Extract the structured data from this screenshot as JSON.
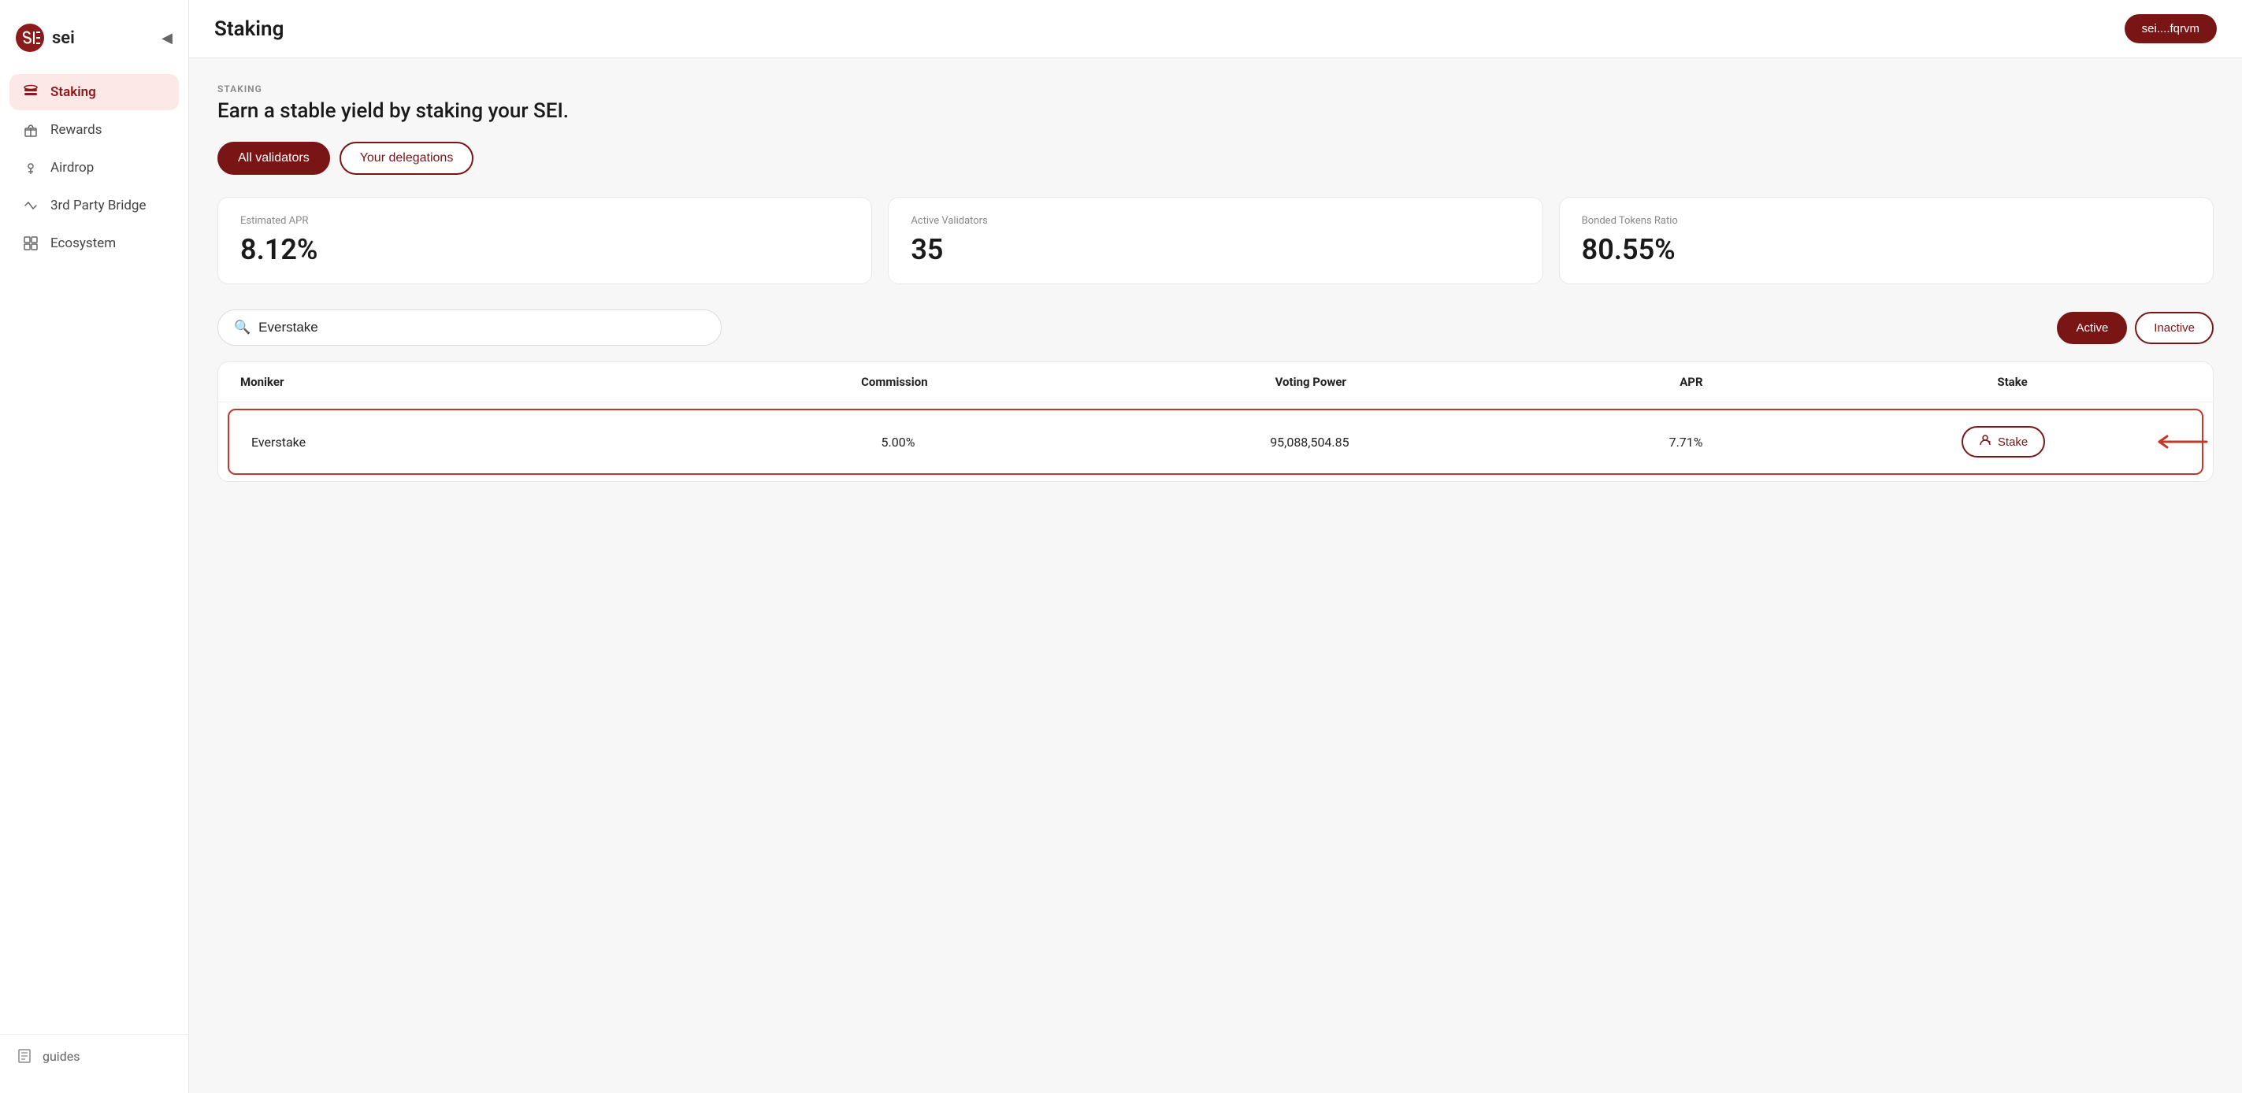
{
  "app": {
    "name": "sei"
  },
  "header": {
    "title": "Staking",
    "wallet": "sei....fqrvm"
  },
  "sidebar": {
    "collapse_icon": "◀",
    "items": [
      {
        "id": "staking",
        "label": "Staking",
        "icon": "staking",
        "active": true
      },
      {
        "id": "rewards",
        "label": "Rewards",
        "icon": "gift",
        "active": false
      },
      {
        "id": "airdrop",
        "label": "Airdrop",
        "icon": "drop",
        "active": false
      },
      {
        "id": "bridge",
        "label": "3rd Party Bridge",
        "icon": "bridge",
        "active": false
      },
      {
        "id": "ecosystem",
        "label": "Ecosystem",
        "icon": "grid",
        "active": false
      }
    ],
    "footer": {
      "guides_label": "guides"
    }
  },
  "staking": {
    "section_label": "STAKING",
    "subtitle": "Earn a stable yield by staking your SEI.",
    "tabs": [
      {
        "id": "all",
        "label": "All validators",
        "active": true
      },
      {
        "id": "delegations",
        "label": "Your delegations",
        "active": false
      }
    ],
    "stats": [
      {
        "label": "Estimated APR",
        "value": "8.12%"
      },
      {
        "label": "Active Validators",
        "value": "35"
      },
      {
        "label": "Bonded Tokens Ratio",
        "value": "80.55%"
      }
    ],
    "search": {
      "placeholder": "Everstake",
      "value": "Everstake"
    },
    "filters": [
      {
        "id": "active",
        "label": "Active",
        "active": true
      },
      {
        "id": "inactive",
        "label": "Inactive",
        "active": false
      }
    ],
    "table": {
      "columns": [
        "Moniker",
        "Commission",
        "Voting Power",
        "APR",
        "Stake"
      ],
      "rows": [
        {
          "moniker": "Everstake",
          "commission": "5.00%",
          "voting_power": "95,088,504.85",
          "apr": "7.71%",
          "stake_label": "Stake"
        }
      ]
    }
  }
}
